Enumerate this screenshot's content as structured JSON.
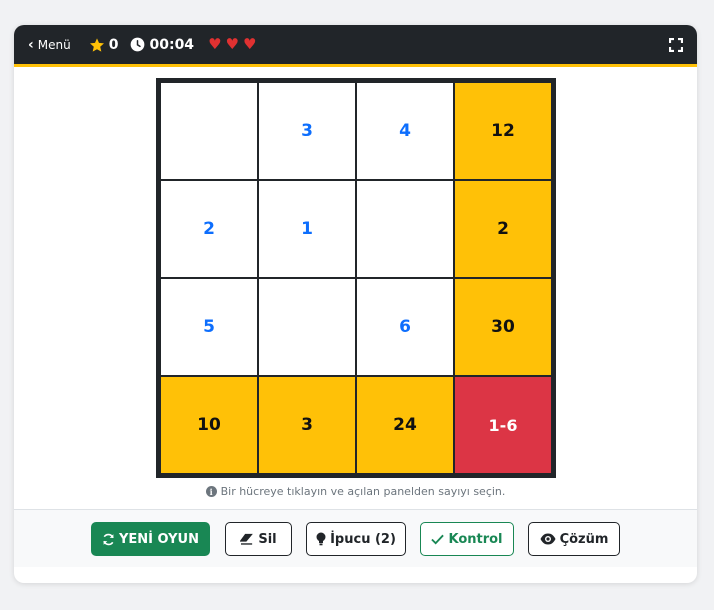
{
  "topbar": {
    "menu_label": "Menü",
    "stars": "0",
    "timer": "00:04",
    "lives": 3
  },
  "board": {
    "cells": [
      {
        "value": "",
        "type": "empty"
      },
      {
        "value": "3",
        "type": "empty"
      },
      {
        "value": "4",
        "type": "empty"
      },
      {
        "value": "12",
        "type": "sum"
      },
      {
        "value": "2",
        "type": "empty"
      },
      {
        "value": "1",
        "type": "empty"
      },
      {
        "value": "",
        "type": "empty"
      },
      {
        "value": "2",
        "type": "sum"
      },
      {
        "value": "5",
        "type": "empty"
      },
      {
        "value": "",
        "type": "empty"
      },
      {
        "value": "6",
        "type": "empty"
      },
      {
        "value": "30",
        "type": "sum"
      },
      {
        "value": "10",
        "type": "sum"
      },
      {
        "value": "3",
        "type": "sum"
      },
      {
        "value": "24",
        "type": "sum"
      },
      {
        "value": "1-6",
        "type": "range"
      }
    ]
  },
  "hint_text": "Bir hücreye tıklayın ve açılan panelden sayıyı seçin.",
  "buttons": {
    "new_game": "YENİ OYUN",
    "delete": "Sil",
    "hint": "İpucu (2)",
    "check": "Kontrol",
    "solution": "Çözüm"
  },
  "colors": {
    "topbar": "#212529",
    "accent": "#ffc107",
    "number_blue": "#0d6efd",
    "range_red": "#dc3545",
    "green": "#198754"
  }
}
